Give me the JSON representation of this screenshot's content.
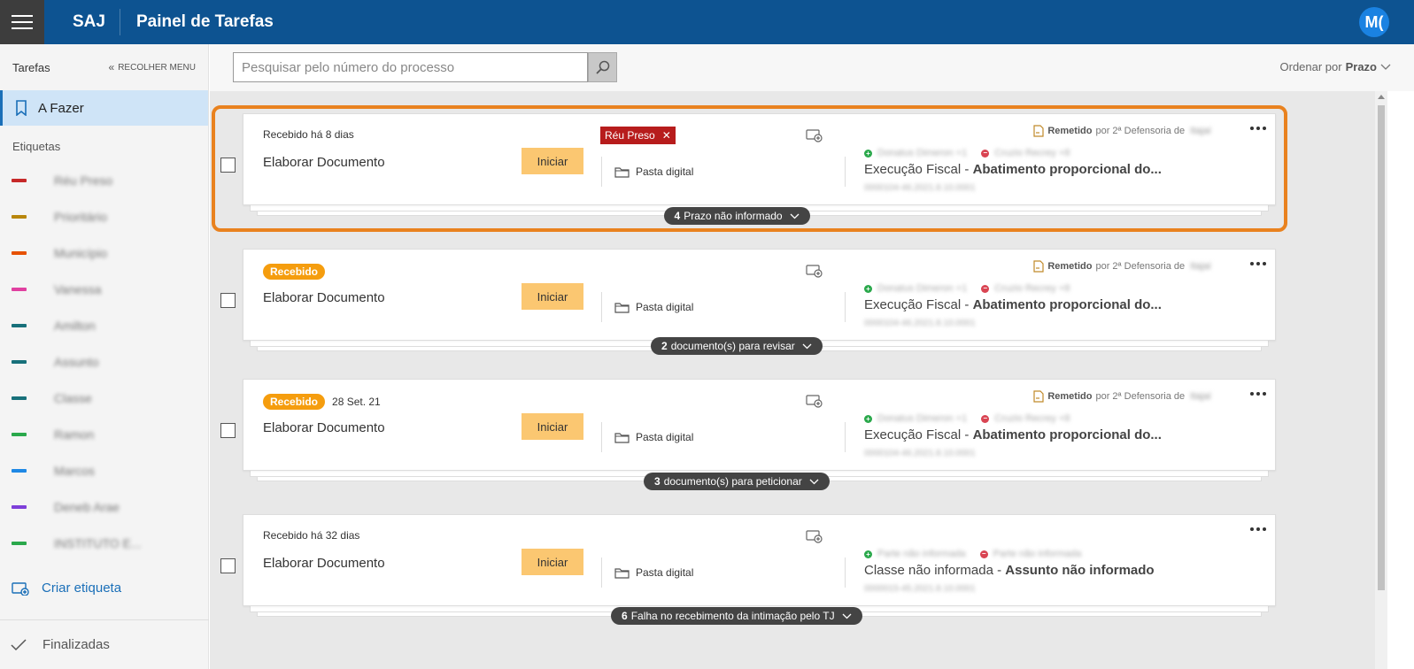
{
  "header": {
    "app_name": "SAJ",
    "title": "Painel de Tarefas",
    "avatar_initials": "M("
  },
  "sidebar": {
    "title": "Tarefas",
    "collapse_label": "RECOLHER MENU",
    "active_item": "A Fazer",
    "section_label": "Etiquetas",
    "tags": [
      {
        "label": "Réu Preso",
        "color": "#c62828"
      },
      {
        "label": "Prioritário",
        "color": "#b8860b"
      },
      {
        "label": "Município",
        "color": "#e65100"
      },
      {
        "label": "Vanessa",
        "color": "#e040a0"
      },
      {
        "label": "Amilton",
        "color": "#17707a"
      },
      {
        "label": "Assunto",
        "color": "#17707a"
      },
      {
        "label": "Classe",
        "color": "#17707a"
      },
      {
        "label": "Ramon",
        "color": "#2aa84b"
      },
      {
        "label": "Marcos",
        "color": "#1e88e5"
      },
      {
        "label": "Deneb Arae",
        "color": "#7e3fd9"
      },
      {
        "label": "INSTITUTO E...",
        "color": "#2aa84b"
      }
    ],
    "create_label": "Criar etiqueta",
    "footer_label": "Finalizadas"
  },
  "toolbar": {
    "search_placeholder": "Pesquisar pelo número do processo",
    "sort_label": "Ordenar por",
    "sort_value": "Prazo"
  },
  "tasks": [
    {
      "top_text": "Recebido há 8 dias",
      "badge": "",
      "date": "",
      "title": "Elaborar Documento",
      "start_label": "Iniciar",
      "tag": "Réu Preso",
      "folder_label": "Pasta digital",
      "remetido_label": "Remetido",
      "remetido_by": "por 2ª Defensoria de",
      "remetido_place": "Itajaí",
      "party_plus": "Donatus Dimeron +1",
      "party_minus": "Cruzio Recrey +8",
      "case_class": "Execução Fiscal",
      "case_subject": "Abatimento proporcional do...",
      "case_number": "0000104-46.2021.8.10.0001",
      "pill_count": "4",
      "pill_text": "Prazo não informado"
    },
    {
      "top_text": "",
      "badge": "Recebido",
      "date": "",
      "title": "Elaborar Documento",
      "start_label": "Iniciar",
      "tag": "",
      "folder_label": "Pasta digital",
      "remetido_label": "Remetido",
      "remetido_by": "por 2ª Defensoria de",
      "remetido_place": "Itajaí",
      "party_plus": "Donatus Dimeron +1",
      "party_minus": "Cruzio Recrey +8",
      "case_class": "Execução Fiscal",
      "case_subject": "Abatimento proporcional do...",
      "case_number": "0000104-46.2021.8.10.0001",
      "pill_count": "2",
      "pill_text": "documento(s) para revisar"
    },
    {
      "top_text": "",
      "badge": "Recebido",
      "date": "28 Set. 21",
      "title": "Elaborar Documento",
      "start_label": "Iniciar",
      "tag": "",
      "folder_label": "Pasta digital",
      "remetido_label": "Remetido",
      "remetido_by": "por 2ª Defensoria de",
      "remetido_place": "Itajaí",
      "party_plus": "Donatus Dimeron +1",
      "party_minus": "Cruzio Recrey +8",
      "case_class": "Execução Fiscal",
      "case_subject": "Abatimento proporcional do...",
      "case_number": "0000104-46.2021.8.10.0001",
      "pill_count": "3",
      "pill_text": "documento(s) para peticionar"
    },
    {
      "top_text": "Recebido há 32 dias",
      "badge": "",
      "date": "",
      "title": "Elaborar Documento",
      "start_label": "Iniciar",
      "tag": "",
      "folder_label": "Pasta digital",
      "remetido_label": "",
      "remetido_by": "",
      "remetido_place": "",
      "party_plus": "Parte não informada",
      "party_minus": "Parte não informada",
      "case_class": "Classe não informada",
      "case_subject": "Assunto não informado",
      "case_number": "0000015-45.2021.8.10.0001",
      "pill_count": "6",
      "pill_text": "Falha no recebimento da intimação pelo TJ"
    }
  ]
}
